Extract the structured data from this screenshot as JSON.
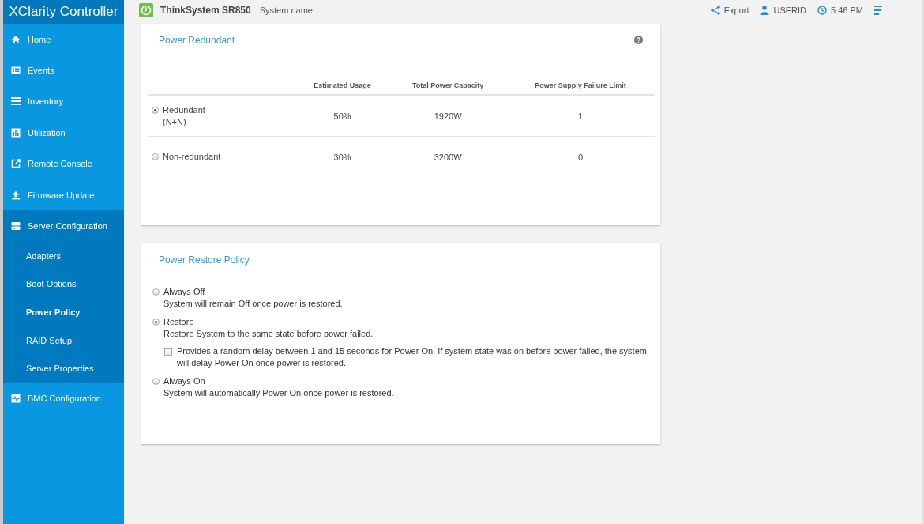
{
  "brand": {
    "logo": "XClarity Controller"
  },
  "sidebar": {
    "items": [
      {
        "label": "Home",
        "expanded": false
      },
      {
        "label": "Events",
        "expanded": false
      },
      {
        "label": "Inventory",
        "expanded": false
      },
      {
        "label": "Utilization",
        "expanded": false
      },
      {
        "label": "Remote Console",
        "expanded": false
      },
      {
        "label": "Firmware Update",
        "expanded": false
      },
      {
        "label": "Server Configuration",
        "expanded": true,
        "children": [
          {
            "label": "Adapters",
            "selected": false
          },
          {
            "label": "Boot Options",
            "selected": false
          },
          {
            "label": "Power Policy",
            "selected": true
          },
          {
            "label": "RAID Setup",
            "selected": false
          },
          {
            "label": "Server Properties",
            "selected": false
          }
        ]
      },
      {
        "label": "BMC Configuration",
        "expanded": false
      }
    ]
  },
  "topbar": {
    "model": "ThinkSystem SR850",
    "system_name_label": "System name:",
    "export": "Export",
    "user": "USERID",
    "time": "5:46 PM"
  },
  "power_redundant": {
    "title": "Power Redundant",
    "table": {
      "columns": [
        "Estimated Usage",
        "Total Power Capacity",
        "Power Supply Failure Limit"
      ],
      "rows": [
        {
          "label": "Redundant",
          "label_2": "(N+N)",
          "selected": true,
          "cells": [
            "50%",
            "1920W",
            "1"
          ]
        },
        {
          "label": "Non-redundant",
          "selected": false,
          "cells": [
            "30%",
            "3200W",
            "0"
          ]
        }
      ]
    }
  },
  "power_restore_policy": {
    "title": "Power Restore Policy",
    "options": [
      {
        "label": "Always Off",
        "description": "System will remain Off once power is restored.",
        "selected": false
      },
      {
        "label": "Restore",
        "description": "Restore System to the same state before power failed.",
        "selected": true,
        "sub_option": {
          "text": "Provides a random delay between 1 and 15 seconds for Power On. If system state was on before power failed, the system will delay Power On once power is restored.",
          "checked": false
        }
      },
      {
        "label": "Always On",
        "description": "System will automatically Power On once power is restored.",
        "selected": false
      }
    ]
  }
}
